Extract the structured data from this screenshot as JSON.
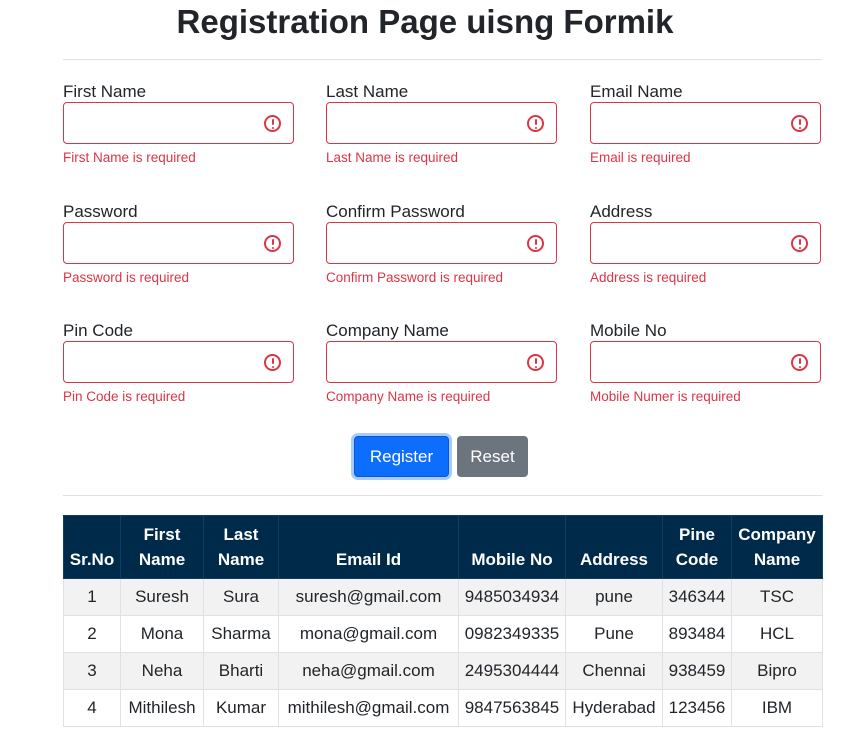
{
  "page": {
    "title": "Registration Page uisng Formik"
  },
  "form": {
    "fields": [
      {
        "label": "First Name",
        "value": "",
        "error": "First Name is required"
      },
      {
        "label": "Last Name",
        "value": "",
        "error": "Last Name is required"
      },
      {
        "label": "Email Name",
        "value": "",
        "error": "Email is required"
      },
      {
        "label": "Password",
        "value": "",
        "error": "Password is required"
      },
      {
        "label": "Confirm Password",
        "value": "",
        "error": "Confirm Password is required"
      },
      {
        "label": "Address",
        "value": "",
        "error": "Address is required"
      },
      {
        "label": "Pin Code",
        "value": "",
        "error": "Pin Code is required"
      },
      {
        "label": "Company Name",
        "value": "",
        "error": "Company Name is required"
      },
      {
        "label": "Mobile No",
        "value": "",
        "error": "Mobile Numer is required"
      }
    ],
    "register_label": "Register",
    "reset_label": "Reset"
  },
  "table": {
    "headers": [
      "Sr.No",
      "First Name",
      "Last Name",
      "Email Id",
      "Mobile No",
      "Address",
      "Pine Code",
      "Company Name"
    ],
    "rows": [
      [
        "1",
        "Suresh",
        "Sura",
        "suresh@gmail.com",
        "9485034934",
        "pune",
        "346344",
        "TSC"
      ],
      [
        "2",
        "Mona",
        "Sharma",
        "mona@gmail.com",
        "0982349335",
        "Pune",
        "893484",
        "HCL"
      ],
      [
        "3",
        "Neha",
        "Bharti",
        "neha@gmail.com",
        "2495304444",
        "Chennai",
        "938459",
        "Bipro"
      ],
      [
        "4",
        "Mithilesh",
        "Kumar",
        "mithilesh@gmail.com",
        "9847563845",
        "Hyderabad",
        "123456",
        "IBM"
      ]
    ]
  },
  "colors": {
    "error": "#dc3545",
    "primary": "#0d6efd",
    "secondary": "#6c757d",
    "table_header": "#002a4a"
  },
  "icons": {
    "field_error": "exclamation-circle-icon"
  }
}
